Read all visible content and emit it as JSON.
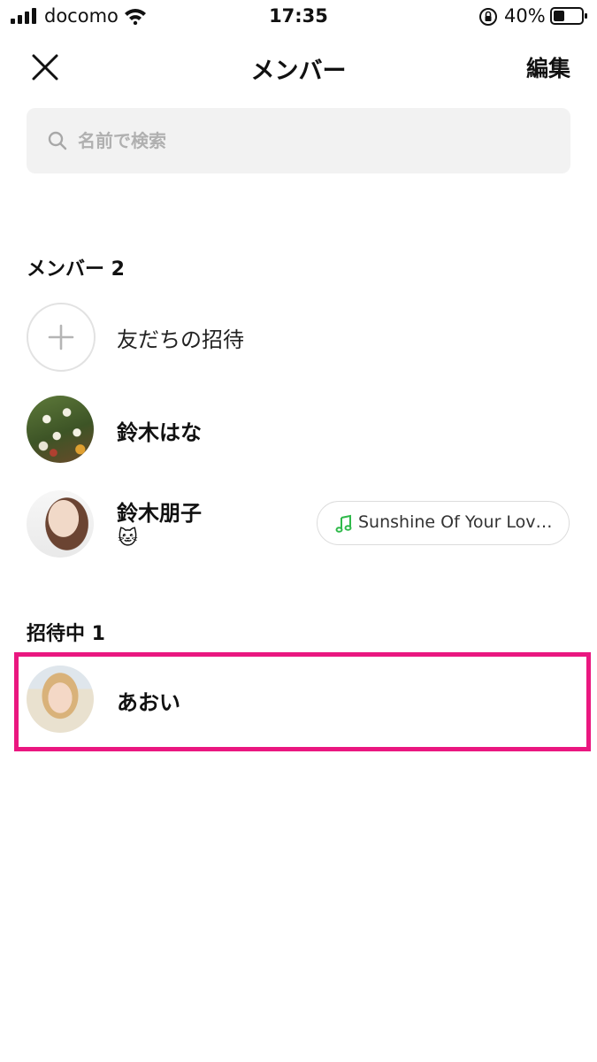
{
  "status_bar": {
    "carrier": "docomo",
    "time": "17:35",
    "battery": "40%",
    "battery_level": 0.4
  },
  "header": {
    "title": "メンバー",
    "edit_label": "編集",
    "close_icon": "close-icon"
  },
  "search": {
    "placeholder": "名前で検索",
    "value": ""
  },
  "members_section": {
    "label": "メンバー 2",
    "invite_label": "友だちの招待",
    "members": [
      {
        "name": "鈴木はな",
        "avatar": "flower-photo"
      },
      {
        "name": "鈴木朋子",
        "status_emoji": "🐱",
        "avatar": "person-photo",
        "music": "Sunshine Of Your Lov…"
      }
    ]
  },
  "invited_section": {
    "label": "招待中 1",
    "members": [
      {
        "name": "あおい",
        "avatar": "avatar-3d-photo"
      }
    ]
  },
  "colors": {
    "highlight": "#ea1780",
    "music_green": "#2fb94a",
    "search_bg": "#f2f2f2"
  }
}
